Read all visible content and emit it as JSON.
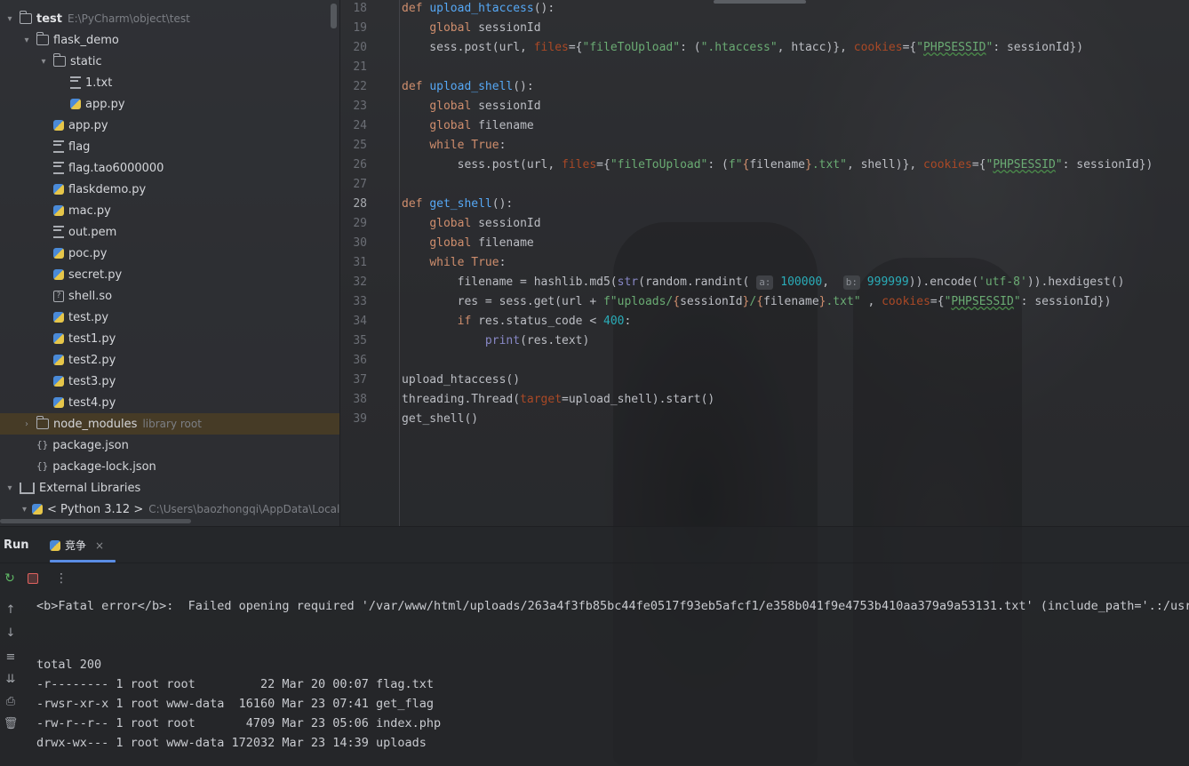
{
  "project_tree": [
    {
      "label": "test",
      "hint": "E:\\PyCharm\\object\\test",
      "type": "folder",
      "chevron": "▾",
      "indent": 0,
      "bold": true
    },
    {
      "label": "flask_demo",
      "type": "folder",
      "chevron": "▾",
      "indent": 1
    },
    {
      "label": "static",
      "type": "folder",
      "chevron": "▾",
      "indent": 2
    },
    {
      "label": "1.txt",
      "type": "txt",
      "indent": 3
    },
    {
      "label": "app.py",
      "type": "py",
      "indent": 3
    },
    {
      "label": "app.py",
      "type": "py",
      "indent": 2
    },
    {
      "label": "flag",
      "type": "txt",
      "indent": 2
    },
    {
      "label": "flag.tao6000000",
      "type": "txt",
      "indent": 2
    },
    {
      "label": "flaskdemo.py",
      "type": "py",
      "indent": 2
    },
    {
      "label": "mac.py",
      "type": "py",
      "indent": 2
    },
    {
      "label": "out.pem",
      "type": "txt",
      "indent": 2
    },
    {
      "label": "poc.py",
      "type": "py",
      "indent": 2
    },
    {
      "label": "secret.py",
      "type": "py",
      "indent": 2
    },
    {
      "label": "shell.so",
      "type": "unk",
      "indent": 2
    },
    {
      "label": "test.py",
      "type": "py",
      "indent": 2
    },
    {
      "label": "test1.py",
      "type": "py",
      "indent": 2
    },
    {
      "label": "test2.py",
      "type": "py",
      "indent": 2
    },
    {
      "label": "test3.py",
      "type": "py",
      "indent": 2
    },
    {
      "label": "test4.py",
      "type": "py",
      "indent": 2
    },
    {
      "label": "node_modules",
      "hint": "library root",
      "type": "folder",
      "chevron": "›",
      "indent": 1,
      "selected": true
    },
    {
      "label": "package.json",
      "type": "json",
      "indent": 1
    },
    {
      "label": "package-lock.json",
      "type": "json",
      "indent": 1
    },
    {
      "label": "External Libraries",
      "type": "lib",
      "chevron": "▾",
      "indent": 0
    },
    {
      "label": "< Python 3.12 >",
      "hint": "C:\\Users\\baozhongqi\\AppData\\Local\\",
      "type": "py",
      "chevron": "▾",
      "indent": 1
    }
  ],
  "editor": {
    "current_line": 28,
    "line_numbers": [
      18,
      19,
      20,
      21,
      22,
      23,
      24,
      25,
      26,
      27,
      28,
      29,
      30,
      31,
      32,
      33,
      34,
      35,
      36,
      37,
      38,
      39
    ],
    "hints": {
      "a": "a:",
      "b": "b:"
    }
  },
  "run": {
    "title": "Run",
    "tab_label": "竞争",
    "tab_close": "×",
    "console_lines": [
      "<b>Fatal error</b>:  Failed opening required '/var/www/html/uploads/263a4f3fb85bc44fe0517f93eb5afcf1/e358b041f9e4753b410aa379a9a53131.txt' (include_path='.:/usr/l",
      "",
      "",
      "total 200",
      "-r-------- 1 root root         22 Mar 20 00:07 flag.txt",
      "-rwsr-xr-x 1 root www-data  16160 Mar 23 07:41 get_flag",
      "-rw-r--r-- 1 root root       4709 Mar 23 05:06 index.php",
      "drwx-wx--- 1 root www-data 172032 Mar 23 14:39 uploads"
    ]
  },
  "icons": {
    "rerun": "rerun-icon",
    "stop": "stop-icon",
    "more": "more-icon",
    "up": "arrow-up-icon",
    "down": "arrow-down-icon",
    "wrap": "soft-wrap-icon",
    "scroll_end": "scroll-to-end-icon",
    "print": "print-icon",
    "trash": "trash-icon"
  },
  "colors": {
    "keyword": "#cf8e6d",
    "function": "#56a8f5",
    "string": "#6aab73",
    "number": "#2aacb8",
    "accent": "#5a8de5"
  }
}
